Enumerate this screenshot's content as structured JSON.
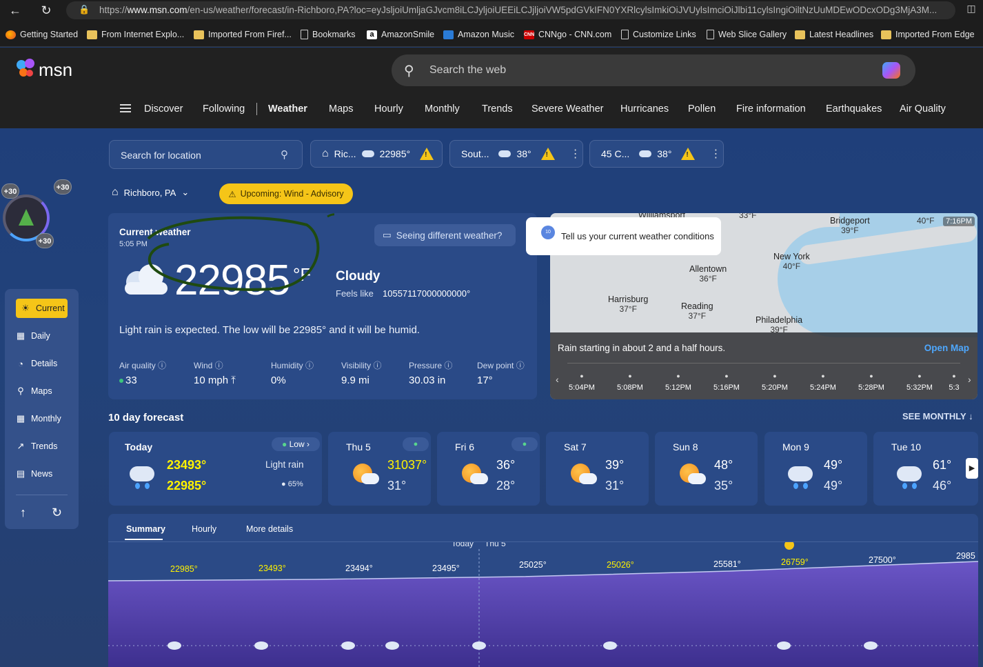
{
  "browser": {
    "url_prefix": "https://",
    "url_domain": "www.msn.com",
    "url_rest": "/en-us/weather/forecast/in-Richboro,PA?loc=eyJsljoiUmljaGJvcm8iLCJyljoiUEEiLCJjljoiVW5pdGVkIFN0YXRlcylsImkiOiJVUylsImciOiJlbi11cylsIngiOiltNzUuMDEwODcxODg3MjA3M...",
    "favorites": [
      {
        "label": "Getting Started",
        "icon": "firefox-icon"
      },
      {
        "label": "From Internet Explo...",
        "icon": "folder-icon"
      },
      {
        "label": "Imported From Firef...",
        "icon": "folder-icon"
      },
      {
        "label": "Bookmarks",
        "icon": "page-icon"
      },
      {
        "label": "AmazonSmile",
        "icon": "amazon-icon"
      },
      {
        "label": "Amazon Music",
        "icon": "amazon-music-icon"
      },
      {
        "label": "CNNgo - CNN.com",
        "icon": "cnn-icon"
      },
      {
        "label": "Customize Links",
        "icon": "page-icon"
      },
      {
        "label": "Web Slice Gallery",
        "icon": "page-icon"
      },
      {
        "label": "Latest Headlines",
        "icon": "folder-icon"
      },
      {
        "label": "Imported From Edge",
        "icon": "folder-icon"
      }
    ]
  },
  "header": {
    "logo_text": "msn",
    "search_placeholder": "Search the web",
    "nav": [
      "Discover",
      "Following",
      "Weather",
      "Maps",
      "Hourly",
      "Monthly",
      "Trends",
      "Severe Weather",
      "Hurricanes",
      "Pollen",
      "Fire information",
      "Earthquakes",
      "Air Quality"
    ],
    "active_nav": "Weather"
  },
  "locations": {
    "search_placeholder": "Search for location",
    "chips": [
      {
        "name": "Ric...",
        "temp": "22985°",
        "home": true
      },
      {
        "name": "Sout...",
        "temp": "38°",
        "home": false
      },
      {
        "name": "45 C...",
        "temp": "38°",
        "home": false
      }
    ],
    "current_location": "Richboro, PA",
    "advisory": "Upcoming: Wind - Advisory",
    "alert_badge": "!"
  },
  "badges": {
    "top_left": "+30",
    "top_right": "+30",
    "bottom": "+30"
  },
  "sidebar": {
    "items": [
      {
        "label": "Current",
        "icon": "sun-icon"
      },
      {
        "label": "Daily",
        "icon": "calendar-icon"
      },
      {
        "label": "Details",
        "icon": "details-icon"
      },
      {
        "label": "Maps",
        "icon": "map-pin-icon"
      },
      {
        "label": "Monthly",
        "icon": "grid-icon"
      },
      {
        "label": "Trends",
        "icon": "trend-icon"
      },
      {
        "label": "News",
        "icon": "news-icon"
      }
    ]
  },
  "current": {
    "title": "Current weather",
    "time": "5:05 PM",
    "temp": "22985",
    "unit": "°F",
    "condition": "Cloudy",
    "feels_label": "Feels like",
    "feels_value": "10557117000000000°",
    "seeing_different": "Seeing different weather?",
    "summary": "Light rain is expected. The low will be 22985° and it will be humid.",
    "stats": [
      {
        "label": "Air quality",
        "value": "33"
      },
      {
        "label": "Wind",
        "value": "10 mph"
      },
      {
        "label": "Humidity",
        "value": "0%"
      },
      {
        "label": "Visibility",
        "value": "9.9 mi"
      },
      {
        "label": "Pressure",
        "value": "30.03 in"
      },
      {
        "label": "Dew point",
        "value": "17°"
      }
    ]
  },
  "tooltip": {
    "text": "Tell us your current weather conditions",
    "badge": "10"
  },
  "map": {
    "time": "7:16PM",
    "cities": [
      {
        "name": "Williamsport",
        "temp": "33°F"
      },
      {
        "name": "Bridgeport",
        "temp": "39°F"
      },
      {
        "name": "",
        "temp": "40°F"
      },
      {
        "name": "New York",
        "temp": "40°F"
      },
      {
        "name": "Allentown",
        "temp": "36°F"
      },
      {
        "name": "Harrisburg",
        "temp": "37°F"
      },
      {
        "name": "Reading",
        "temp": "37°F"
      },
      {
        "name": "Philadelphia",
        "temp": "39°F"
      }
    ],
    "message": "Rain starting in about 2 and a half hours.",
    "open_map": "Open Map",
    "times": [
      "5:04PM",
      "5:08PM",
      "5:12PM",
      "5:16PM",
      "5:20PM",
      "5:24PM",
      "5:28PM",
      "5:32PM",
      "5:3"
    ]
  },
  "forecast": {
    "title": "10 day forecast",
    "see_monthly": "SEE MONTHLY",
    "today": {
      "name": "Today",
      "hi": "23493°",
      "lo": "22985°",
      "pollen": "Low",
      "condition": "Light rain",
      "precip": "65%"
    },
    "days": [
      {
        "name": "Thu 5",
        "hi": "31037°",
        "lo": "31°"
      },
      {
        "name": "Fri 6",
        "hi": "36°",
        "lo": "28°"
      },
      {
        "name": "Sat 7",
        "hi": "39°",
        "lo": "31°"
      },
      {
        "name": "Sun 8",
        "hi": "48°",
        "lo": "35°"
      },
      {
        "name": "Mon 9",
        "hi": "49°",
        "lo": "49°"
      },
      {
        "name": "Tue 10",
        "hi": "61°",
        "lo": "46°"
      }
    ]
  },
  "summary_panel": {
    "tabs": [
      "Summary",
      "Hourly",
      "More details"
    ],
    "day_labels": [
      "Today",
      "Thu 5"
    ],
    "temps": [
      "22985°",
      "23493°",
      "23494°",
      "23495°",
      "25025°",
      "25026°",
      "25581°",
      "26759°",
      "27500°",
      "2985"
    ]
  },
  "colors": {
    "accent_yellow": "#f5c518",
    "card": "#2a4a87",
    "link": "#4ea8ff"
  }
}
